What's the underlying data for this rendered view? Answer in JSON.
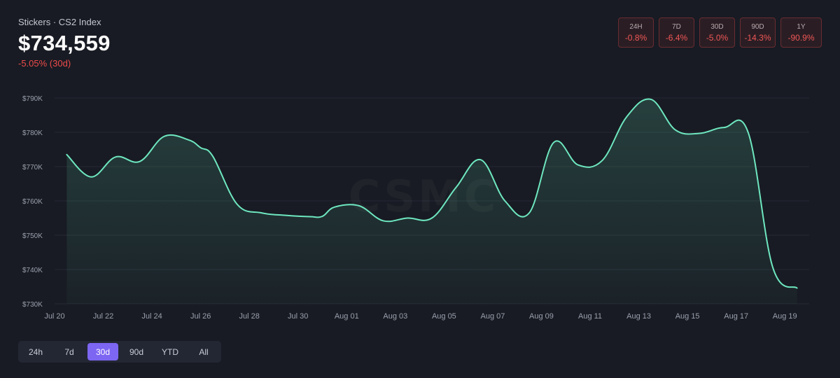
{
  "header": {
    "subtitle": "Stickers · CS2 Index",
    "price": "$734,559",
    "change": "-5.05% (30d)"
  },
  "periods": [
    {
      "label": "24H",
      "value": "-0.8%"
    },
    {
      "label": "7D",
      "value": "-6.4%"
    },
    {
      "label": "30D",
      "value": "-5.0%"
    },
    {
      "label": "90D",
      "value": "-14.3%"
    },
    {
      "label": "1Y",
      "value": "-90.9%"
    }
  ],
  "ranges": [
    {
      "label": "24h",
      "active": false
    },
    {
      "label": "7d",
      "active": false
    },
    {
      "label": "30d",
      "active": true
    },
    {
      "label": "90d",
      "active": false
    },
    {
      "label": "YTD",
      "active": false
    },
    {
      "label": "All",
      "active": false
    }
  ],
  "watermark": "CSMC",
  "colors": {
    "line": "#6ee7bf",
    "negative": "#ef4b4b",
    "accent": "#7c66f2",
    "background": "#181b23"
  },
  "chart_data": {
    "type": "area",
    "x_start": "2025-07-20",
    "x_end": "2025-08-20",
    "ylim": [
      730000,
      790000
    ],
    "yticks": [
      730000,
      740000,
      750000,
      760000,
      770000,
      780000,
      790000
    ],
    "ytick_labels": [
      "$730K",
      "$740K",
      "$750K",
      "$760K",
      "$770K",
      "$780K",
      "$790K"
    ],
    "xticks": [
      "2025-07-20",
      "2025-07-22",
      "2025-07-24",
      "2025-07-26",
      "2025-07-28",
      "2025-07-30",
      "2025-08-01",
      "2025-08-03",
      "2025-08-05",
      "2025-08-07",
      "2025-08-09",
      "2025-08-11",
      "2025-08-13",
      "2025-08-15",
      "2025-08-17",
      "2025-08-19"
    ],
    "xtick_labels": [
      "Jul 20",
      "Jul 22",
      "Jul 24",
      "Jul 26",
      "Jul 28",
      "Jul 30",
      "Aug 01",
      "Aug 03",
      "Aug 05",
      "Aug 07",
      "Aug 09",
      "Aug 11",
      "Aug 13",
      "Aug 15",
      "Aug 17",
      "Aug 19"
    ],
    "grid": true,
    "series": [
      {
        "points": [
          [
            "2025-07-20 12:00",
            773500
          ],
          [
            "2025-07-21 12:00",
            767000
          ],
          [
            "2025-07-22 12:00",
            772800
          ],
          [
            "2025-07-23 12:00",
            771500
          ],
          [
            "2025-07-24 12:00",
            778800
          ],
          [
            "2025-07-25 12:00",
            777800
          ],
          [
            "2025-07-26 00:00",
            775500
          ],
          [
            "2025-07-26 12:00",
            773000
          ],
          [
            "2025-07-27 12:00",
            759000
          ],
          [
            "2025-07-28 12:00",
            756500
          ],
          [
            "2025-07-29 12:00",
            755800
          ],
          [
            "2025-07-30 12:00",
            755400
          ],
          [
            "2025-07-31 00:00",
            755500
          ],
          [
            "2025-07-31 12:00",
            758200
          ],
          [
            "2025-08-01 12:00",
            758600
          ],
          [
            "2025-08-02 12:00",
            754200
          ],
          [
            "2025-08-03 12:00",
            755000
          ],
          [
            "2025-08-04 12:00",
            755000
          ],
          [
            "2025-08-05 12:00",
            764000
          ],
          [
            "2025-08-06 12:00",
            772000
          ],
          [
            "2025-08-07 12:00",
            760000
          ],
          [
            "2025-08-08 12:00",
            756500
          ],
          [
            "2025-08-09 12:00",
            777000
          ],
          [
            "2025-08-10 12:00",
            770500
          ],
          [
            "2025-08-11 12:00",
            771800
          ],
          [
            "2025-08-12 12:00",
            784500
          ],
          [
            "2025-08-13 12:00",
            789600
          ],
          [
            "2025-08-14 12:00",
            780700
          ],
          [
            "2025-08-15 12:00",
            779700
          ],
          [
            "2025-08-16 12:00",
            781400
          ],
          [
            "2025-08-17 12:00",
            779800
          ],
          [
            "2025-08-18 12:00",
            740700
          ],
          [
            "2025-08-19 12:00",
            734600
          ]
        ]
      }
    ]
  }
}
